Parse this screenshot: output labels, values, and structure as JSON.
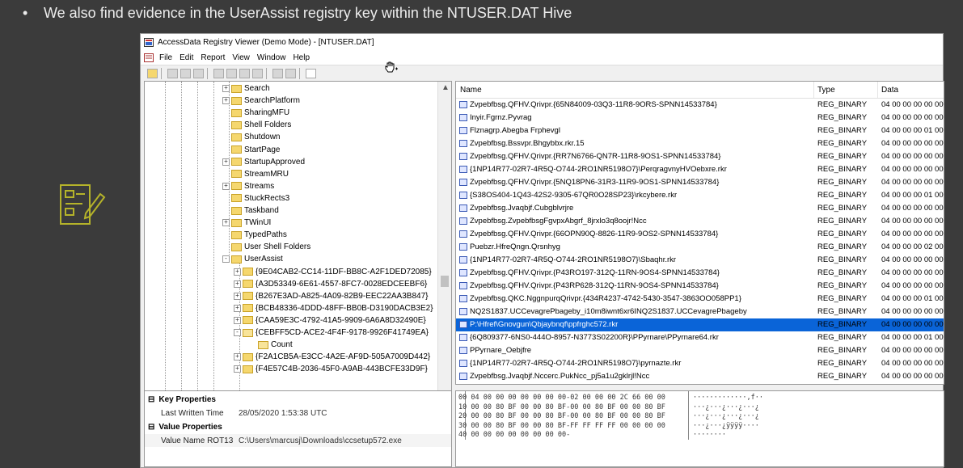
{
  "slide": {
    "bullet": "•",
    "text": "We also find evidence in the UserAssist registry key within the NTUSER.DAT Hive",
    "icon": "notes-edit-icon",
    "icon_color": "#b5b32a"
  },
  "window": {
    "title": "AccessData Registry Viewer (Demo Mode) - [NTUSER.DAT]",
    "menu": [
      "File",
      "Edit",
      "Report",
      "View",
      "Window",
      "Help"
    ]
  },
  "tree": {
    "items": [
      {
        "label": "Search",
        "expander": "+"
      },
      {
        "label": "SearchPlatform",
        "expander": "+"
      },
      {
        "label": "SharingMFU",
        "expander": ""
      },
      {
        "label": "Shell Folders",
        "expander": ""
      },
      {
        "label": "Shutdown",
        "expander": ""
      },
      {
        "label": "StartPage",
        "expander": ""
      },
      {
        "label": "StartupApproved",
        "expander": "+"
      },
      {
        "label": "StreamMRU",
        "expander": ""
      },
      {
        "label": "Streams",
        "expander": "+"
      },
      {
        "label": "StuckRects3",
        "expander": ""
      },
      {
        "label": "Taskband",
        "expander": ""
      },
      {
        "label": "TWinUI",
        "expander": "+"
      },
      {
        "label": "TypedPaths",
        "expander": ""
      },
      {
        "label": "User Shell Folders",
        "expander": ""
      },
      {
        "label": "UserAssist",
        "expander": "-"
      }
    ],
    "guids": [
      {
        "label": "{9E04CAB2-CC14-11DF-BB8C-A2F1DED72085}",
        "expander": "+"
      },
      {
        "label": "{A3D53349-6E61-4557-8FC7-0028EDCEEBF6}",
        "expander": "+"
      },
      {
        "label": "{B267E3AD-A825-4A09-82B9-EEC22AA3B847}",
        "expander": "+"
      },
      {
        "label": "{BCB48336-4DDD-48FF-BB0B-D3190DACB3E2}",
        "expander": "+"
      },
      {
        "label": "{CAA59E3C-4792-41A5-9909-6A6A8D32490E}",
        "expander": "+"
      },
      {
        "label": "{CEBFF5CD-ACE2-4F4F-9178-9926F41749EA}",
        "expander": "-"
      }
    ],
    "count_label": "Count",
    "guids_after": [
      {
        "label": "{F2A1CB5A-E3CC-4A2E-AF9D-505A7009D442}",
        "expander": "+"
      },
      {
        "label": "{F4E57C4B-2036-45F0-A9AB-443BCFE33D9F}",
        "expander": "+"
      }
    ]
  },
  "properties": {
    "key_props": "Key Properties",
    "last_written_label": "Last Written Time",
    "last_written_value": "28/05/2020 1:53:38 UTC",
    "value_props": "Value Properties",
    "rot13_label": "Value Name ROT13",
    "rot13_value": "C:\\Users\\marcusj\\Downloads\\ccsetup572.exe"
  },
  "list": {
    "col_name": "Name",
    "col_type": "Type",
    "col_data": "Data",
    "rows": [
      {
        "name": "Zvpebfbsg.QFHV.Qrivpr.{65N84009-03Q3-11R8-9ORS-SPNN14533784}",
        "type": "REG_BINARY",
        "data": "04 00 00 00 00 00 0"
      },
      {
        "name": "Inyir.Fgrnz.Pyvrag",
        "type": "REG_BINARY",
        "data": "04 00 00 00 00 00 0"
      },
      {
        "name": "Flznagrp.Abegba Frphevgl",
        "type": "REG_BINARY",
        "data": "04 00 00 00 01 00 0"
      },
      {
        "name": "Zvpebfbsg.Bssvpr.Bhgybbx.rkr.15",
        "type": "REG_BINARY",
        "data": "04 00 00 00 00 00 0"
      },
      {
        "name": "Zvpebfbsg.QFHV.Qrivpr.{RR7N6766-QN7R-11R8-9OS1-SPNN14533784}",
        "type": "REG_BINARY",
        "data": "04 00 00 00 00 00 0"
      },
      {
        "name": "{1NP14R77-02R7-4R5Q-O744-2RO1NR5198O7}\\PerqragvnyHVOebxre.rkr",
        "type": "REG_BINARY",
        "data": "04 00 00 00 00 00 0"
      },
      {
        "name": "Zvpebfbsg.QFHV.Qrivpr.{5NQ18PN6-31R3-11R9-9OS1-SPNN14533784}",
        "type": "REG_BINARY",
        "data": "04 00 00 00 00 00 0"
      },
      {
        "name": "{S38OS404-1Q43-42S2-9305-67QR0O28SP23}\\rkcybere.rkr",
        "type": "REG_BINARY",
        "data": "04 00 00 00 01 00 0"
      },
      {
        "name": "Zvpebfbsg.Jvaqbjf.Cubgblvrjre",
        "type": "REG_BINARY",
        "data": "04 00 00 00 00 00 0"
      },
      {
        "name": "Zvpebfbsg.ZvpebfbsgFgvpxAbgrf_8jrxlo3q8oojr!Ncc",
        "type": "REG_BINARY",
        "data": "04 00 00 00 00 00 0"
      },
      {
        "name": "Zvpebfbsg.QFHV.Qrivpr.{66OPN90Q-8826-11R9-9OS2-SPNN14533784}",
        "type": "REG_BINARY",
        "data": "04 00 00 00 00 00 0"
      },
      {
        "name": "Puebzr.HfreQngn.Qrsnhyg",
        "type": "REG_BINARY",
        "data": "04 00 00 00 02 00 0"
      },
      {
        "name": "{1NP14R77-02R7-4R5Q-O744-2RO1NR5198O7}\\Sbaqhr.rkr",
        "type": "REG_BINARY",
        "data": "04 00 00 00 00 00 0"
      },
      {
        "name": "Zvpebfbsg.QFHV.Qrivpr.{P43RO197-312Q-11RN-9OS4-SPNN14533784}",
        "type": "REG_BINARY",
        "data": "04 00 00 00 00 00 0"
      },
      {
        "name": "Zvpebfbsg.QFHV.Qrivpr.{P43RP628-312Q-11RN-9OS4-SPNN14533784}",
        "type": "REG_BINARY",
        "data": "04 00 00 00 00 00 0"
      },
      {
        "name": "Zvpebfbsg.QKC.NggnpurqQrivpr.{434R4237-4742-5430-3547-3863OO058PP1}",
        "type": "REG_BINARY",
        "data": "04 00 00 00 01 00 0"
      },
      {
        "name": "NQ2S1837.UCCevagrePbageby_i10m8iwnt6xr6INQ2S1837.UCCevagrePbageby",
        "type": "REG_BINARY",
        "data": "04 00 00 00 00 00 0"
      },
      {
        "name": "P:\\Hfref\\Gnovgun\\Qbjaybnqf\\ppfrghc572.rkr",
        "type": "REG_BINARY",
        "data": "04 00 00 00 00 00 0",
        "selected": true
      },
      {
        "name": "{6Q809377-6NS0-444O-8957-N3773S02200R}\\PPyrnare\\PPyrnare64.rkr",
        "type": "REG_BINARY",
        "data": "04 00 00 00 01 00 0"
      },
      {
        "name": "PPyrnare_Oebjfre",
        "type": "REG_BINARY",
        "data": "04 00 00 00 00 00 0"
      },
      {
        "name": "{1NP14R77-02R7-4R5Q-O744-2RO1NR5198O7}\\pyrnazte.rkr",
        "type": "REG_BINARY",
        "data": "04 00 00 00 00 00 0"
      },
      {
        "name": "Zvpebfbsg.Jvaqbjf.Nccerc.PukNcc_pj5a1u2gklrjl!Ncc",
        "type": "REG_BINARY",
        "data": "04 00 00 00 00 00 0"
      }
    ]
  },
  "hex": {
    "rows": [
      {
        "offset": "00",
        "bytes": "04 00 00 00 00 00 00 00-02 00 00 00 2C 66 00 00",
        "ascii": "·············,f··"
      },
      {
        "offset": "10",
        "bytes": "00 00 80 BF 00 00 80 BF-00 00 80 BF 00 00 80 BF",
        "ascii": "···¿···¿···¿···¿"
      },
      {
        "offset": "20",
        "bytes": "00 00 80 BF 00 00 80 BF-00 00 80 BF 00 00 80 BF",
        "ascii": "···¿···¿···¿···¿"
      },
      {
        "offset": "30",
        "bytes": "00 00 80 BF 00 00 80 BF-FF FF FF FF 00 00 00 00",
        "ascii": "···¿···¿ÿÿÿÿ····"
      },
      {
        "offset": "40",
        "bytes": "00 00 00 00 00 00 00 00-",
        "ascii": "········"
      }
    ]
  },
  "colors": {
    "selection": "#0a64d8",
    "slide_bg": "#3b3b3b",
    "slide_text": "#ececec"
  }
}
